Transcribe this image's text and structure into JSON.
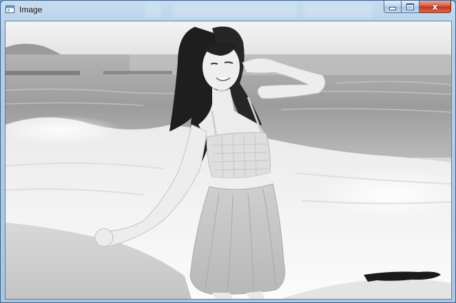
{
  "window": {
    "title": "Image",
    "icon": "window-app-icon",
    "controls": {
      "minimize_icon": "minimize-icon",
      "maximize_icon": "maximize-icon",
      "close_glyph": "x"
    }
  },
  "image": {
    "description_icon": "photo-grayscale",
    "colors": {
      "sky": "#e6e6e6",
      "sea": "#a9a9a9",
      "foam": "#f2f2f2",
      "sand": "#cfcfcf"
    }
  }
}
